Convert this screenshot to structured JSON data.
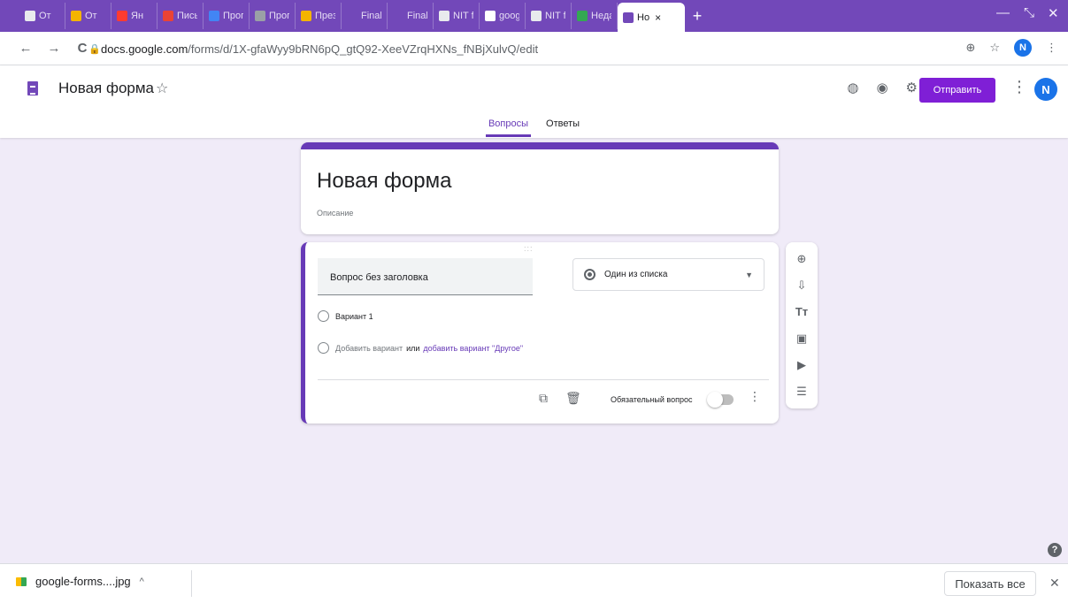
{
  "browser": {
    "tabs": [
      {
        "label": "От",
        "color": "#e8eaed"
      },
      {
        "label": "От",
        "color": "#f4b400"
      },
      {
        "label": "Ян",
        "color": "#ff3b30"
      },
      {
        "label": "Письм",
        "color": "#ea4335"
      },
      {
        "label": "Прогр",
        "color": "#4285f4"
      },
      {
        "label": "Прогр",
        "color": "#9aa0a6"
      },
      {
        "label": "Презе",
        "color": "#f4b400"
      },
      {
        "label": "Final",
        "color": "#7248b9"
      },
      {
        "label": "Final",
        "color": "#7248b9"
      },
      {
        "label": "NIT fo",
        "color": "#e8eaed"
      },
      {
        "label": "googl",
        "color": "#ffffff"
      },
      {
        "label": "NIT fo",
        "color": "#e8eaed"
      },
      {
        "label": "Недав",
        "color": "#34a853"
      }
    ],
    "active_tab": {
      "label": "Но",
      "close": "×"
    },
    "new_tab": "+",
    "window_controls": {
      "minimize": "—",
      "restore": "⤡",
      "close": "✕"
    },
    "url_host": "docs.google.com",
    "url_path": "/forms/d/1X-gfaWyy9bRN6pQ_gtQ92-XeeVZrqHXNs_fNBjXulvQ/edit",
    "profile_initial": "N"
  },
  "header": {
    "doc_title": "Новая форма",
    "send_label": "Отправить",
    "avatar_initial": "N",
    "tabs": [
      {
        "label": "Вопросы",
        "selected": true
      },
      {
        "label": "Ответы",
        "selected": false
      }
    ]
  },
  "form": {
    "title": "Новая форма",
    "description": "Описание"
  },
  "question": {
    "title": "Вопрос без заголовка",
    "type_label": "Один из списка",
    "option1": "Вариант 1",
    "add_option": "Добавить вариант",
    "or": "или",
    "add_other": "добавить вариант \"Другое\"",
    "required_label": "Обязательный вопрос"
  },
  "downloads": {
    "file_name": "google-forms....jpg",
    "show_all": "Показать все"
  },
  "colors": {
    "accent": "#673ab7",
    "send_button": "#7f1fd6",
    "tab_strip": "#7248b9",
    "background": "#f0ebf8"
  }
}
